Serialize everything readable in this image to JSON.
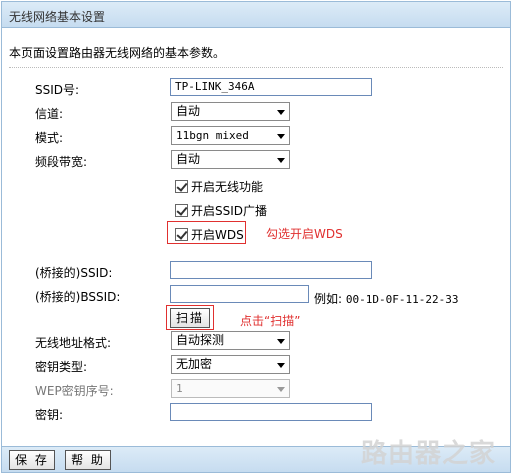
{
  "window": {
    "title": "无线网络基本设置"
  },
  "description": "本页面设置路由器无线网络的基本参数。",
  "form": {
    "ssid": {
      "label": "SSID号:",
      "value": "TP-LINK_346A"
    },
    "channel": {
      "label": "信道:",
      "value": "自动"
    },
    "mode": {
      "label": "模式:",
      "value": "11bgn mixed"
    },
    "bandwidth": {
      "label": "频段带宽:",
      "value": "自动"
    },
    "enable_wireless": {
      "label": "开启无线功能",
      "checked": true
    },
    "enable_ssid_broadcast": {
      "label": "开启SSID广播",
      "checked": true
    },
    "enable_wds": {
      "label": "开启WDS",
      "checked": true
    },
    "bridged_ssid": {
      "label": "(桥接的)SSID:",
      "value": ""
    },
    "bridged_bssid": {
      "label": "(桥接的)BSSID:",
      "value": ""
    },
    "bssid_example_label": "例如:",
    "bssid_example_value": "00-1D-0F-11-22-33",
    "scan_button": "扫描",
    "addr_format": {
      "label": "无线地址格式:",
      "value": "自动探测"
    },
    "key_type": {
      "label": "密钥类型:",
      "value": "无加密"
    },
    "wep_index": {
      "label": "WEP密钥序号:",
      "value": "1"
    },
    "key": {
      "label": "密钥:",
      "value": ""
    }
  },
  "annotations": {
    "wds_note": "勾选开启WDS",
    "scan_note": "点击“扫描”"
  },
  "buttons": {
    "save": "保 存",
    "help": "帮 助"
  },
  "watermark": "路由器之家",
  "colors": {
    "accent_red": "#e0302f",
    "bar_blue": "#c6dcf0"
  }
}
